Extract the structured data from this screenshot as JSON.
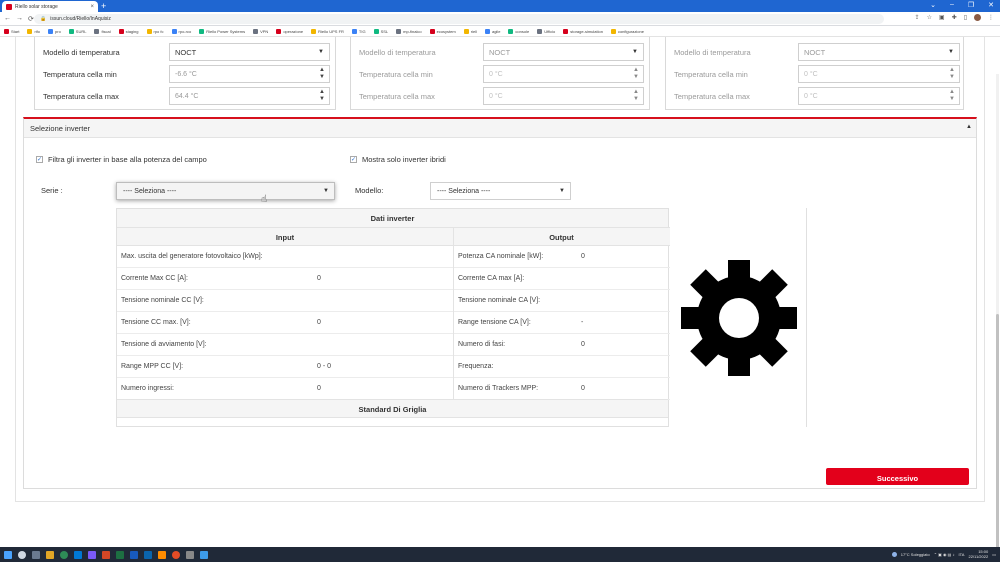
{
  "browser": {
    "tab_title": "Riello solar storage",
    "tab_close": "×",
    "new_tab": "+",
    "url": "issun.cloud/Riello/InAquisiz",
    "window_controls": [
      "⌄",
      "–",
      "❐",
      "✕"
    ]
  },
  "bookmarks": [
    "Start",
    "rifo",
    "pro",
    "SURL",
    "fiscal",
    "staging",
    "rpo fc",
    "rpo-rco",
    "Riello Power Systems",
    "VPN",
    "operazione",
    "Riello UPS FR",
    "TIG",
    "SSL",
    "mp-finalco",
    "ecosystem",
    "riell",
    "agile",
    "console",
    "Ufficio",
    "storage-simulation",
    "configurazione"
  ],
  "temperature_panels": [
    {
      "enabled": true,
      "model_label": "Modello di temperatura",
      "model_value": "NOCT",
      "min_label": "Temperatura cella min",
      "min_value": "-6.6 °C",
      "max_label": "Temperatura cella max",
      "max_value": "64.4 °C"
    },
    {
      "enabled": false,
      "model_label": "Modello di temperatura",
      "model_value": "NOCT",
      "min_label": "Temperatura cella min",
      "min_value": "0 °C",
      "max_label": "Temperatura cella max",
      "max_value": "0 °C"
    },
    {
      "enabled": false,
      "model_label": "Modello di temperatura",
      "model_value": "NOCT",
      "min_label": "Temperatura cella min",
      "min_value": "0 °C",
      "max_label": "Temperatura cella max",
      "max_value": "0 °C"
    }
  ],
  "inverter": {
    "section_title": "Selezione inverter",
    "filter_power_label": "Filtra gli inverter in base alla potenza del campo",
    "filter_power_checked": true,
    "hybrid_only_label": "Mostra solo inverter ibridi",
    "hybrid_only_checked": true,
    "series_label": "Serie :",
    "series_value": "---- Seleziona ----",
    "model_label": "Modello:",
    "model_value": "---- Seleziona ----"
  },
  "data_table": {
    "title": "Dati inverter",
    "input_header": "Input",
    "output_header": "Output",
    "input_rows": [
      {
        "label": "Max. uscita del generatore fotovoltaico [kWp]:",
        "value": ""
      },
      {
        "label": "Corrente Max CC [A]:",
        "value": "0"
      },
      {
        "label": "Tensione nominale CC [V]:",
        "value": ""
      },
      {
        "label": "Tensione CC max. [V]:",
        "value": "0"
      },
      {
        "label": "Tensione di avviamento [V]:",
        "value": ""
      },
      {
        "label": "Range MPP CC [V]:",
        "value": "0 - 0"
      },
      {
        "label": "Numero ingressi:",
        "value": "0"
      }
    ],
    "output_rows": [
      {
        "label": "Potenza CA nominale [kW]:",
        "value": "0"
      },
      {
        "label": "Corrente CA max [A]:",
        "value": ""
      },
      {
        "label": "Tensione nominale CA [V]:",
        "value": ""
      },
      {
        "label": "Range tensione CA [V]:",
        "value": "-"
      },
      {
        "label": "Numero di fasi:",
        "value": "0"
      },
      {
        "label": "Frequenza:",
        "value": ""
      },
      {
        "label": "Numero di Trackers MPP:",
        "value": "0"
      }
    ],
    "footer": "Standard Di Griglia"
  },
  "next_button": "Successivo",
  "taskbar": {
    "weather": "17°C Soleggiato",
    "tray": "ITA",
    "time": "15:00",
    "date": "22/11/2022"
  },
  "colors": {
    "brand_red": "#e3001b",
    "section_red": "#d6101c",
    "browser_blue": "#1f66d1",
    "taskbar": "#202938"
  }
}
